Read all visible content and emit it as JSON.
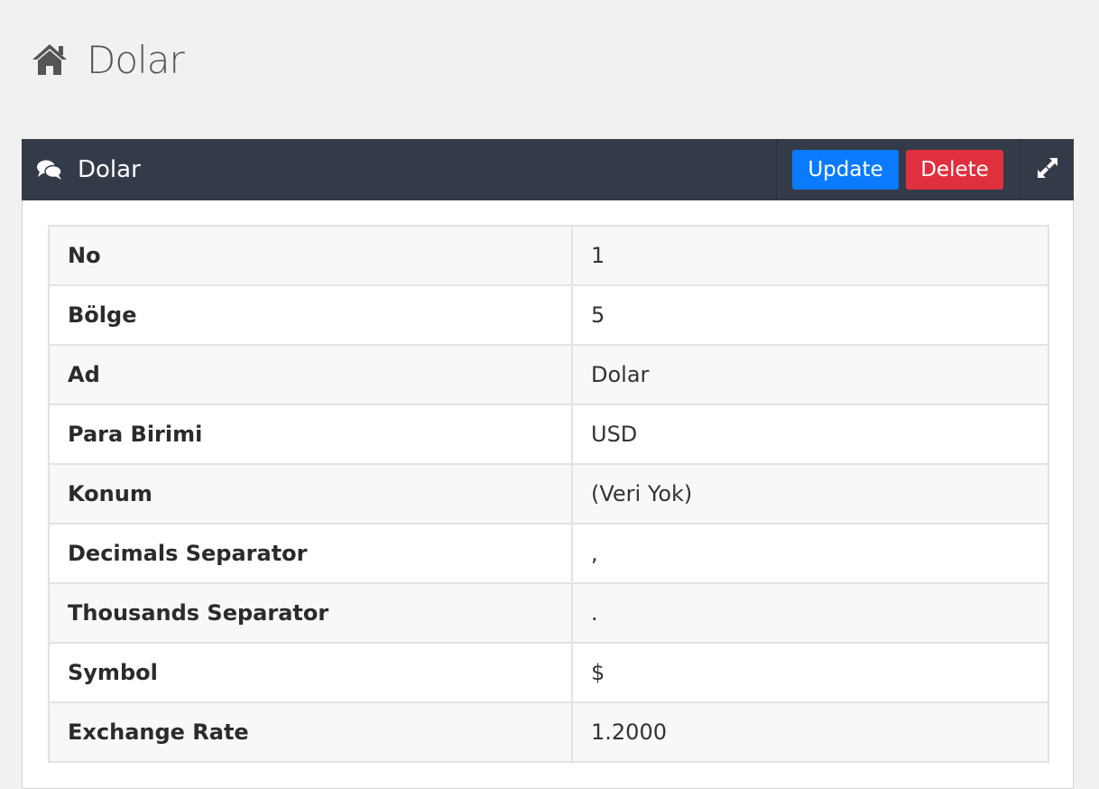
{
  "page": {
    "title": "Dolar",
    "icon": "home-icon"
  },
  "widget": {
    "title": "Dolar",
    "icon": "comments-icon",
    "update_label": "Update",
    "delete_label": "Delete",
    "fullscreen_icon": "expand-icon",
    "colors": {
      "header_bg": "#343b48",
      "update": "#0a7bff",
      "delete": "#e0303e"
    }
  },
  "details": [
    {
      "label": "No",
      "value": "1"
    },
    {
      "label": "Bölge",
      "value": "5"
    },
    {
      "label": "Ad",
      "value": "Dolar"
    },
    {
      "label": "Para Birimi",
      "value": "USD"
    },
    {
      "label": "Konum",
      "value": "(Veri Yok)"
    },
    {
      "label": "Decimals Separator",
      "value": ","
    },
    {
      "label": "Thousands Separator",
      "value": "."
    },
    {
      "label": "Symbol",
      "value": "$"
    },
    {
      "label": "Exchange Rate",
      "value": "1.2000"
    }
  ]
}
